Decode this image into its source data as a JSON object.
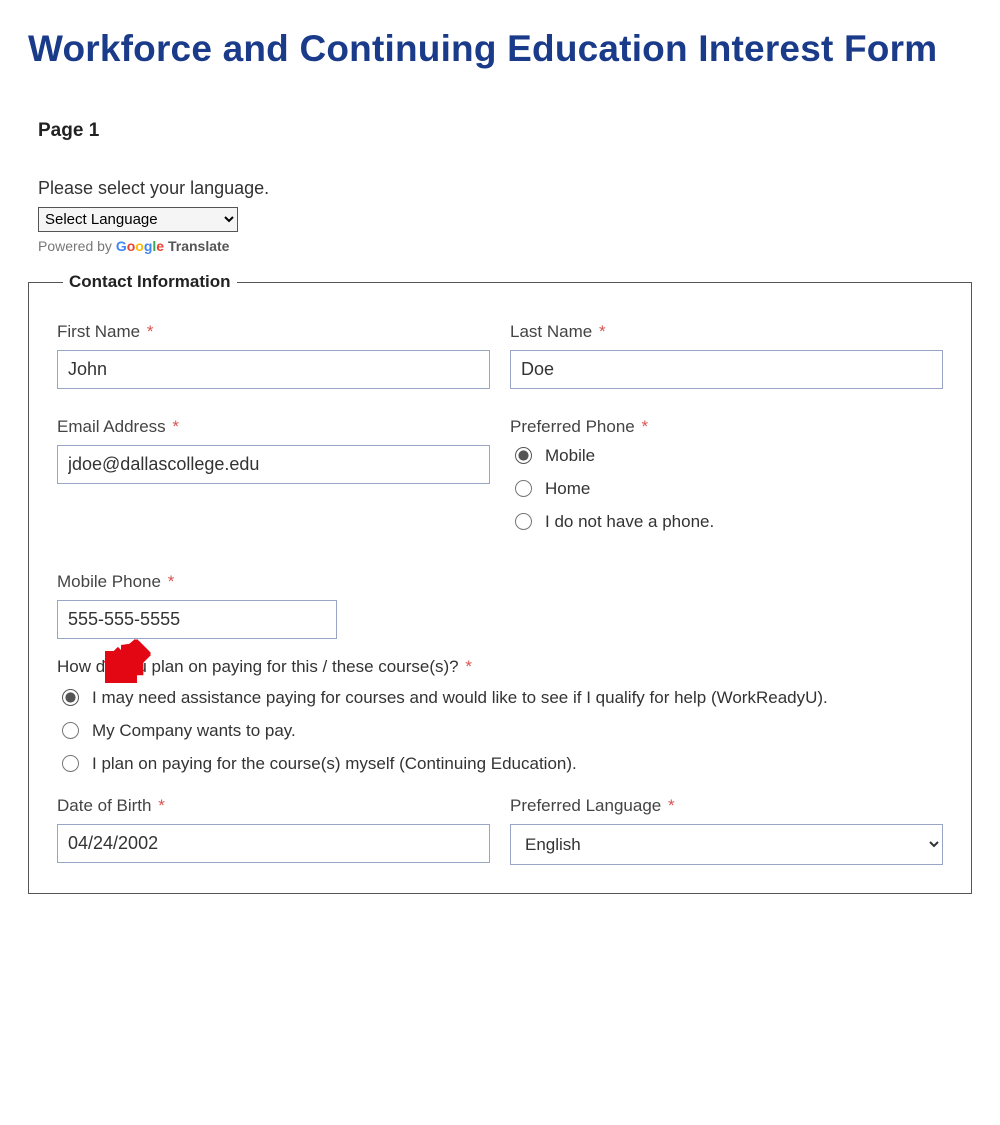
{
  "title": "Workforce and Continuing Education Interest Form",
  "page_label": "Page 1",
  "language": {
    "prompt": "Please select your language.",
    "selected": "Select Language",
    "powered_prefix": "Powered by ",
    "translate_word": "Translate"
  },
  "fieldset_legend": "Contact Information",
  "fields": {
    "first_name": {
      "label": "First Name",
      "value": "John"
    },
    "last_name": {
      "label": "Last Name",
      "value": "Doe"
    },
    "email": {
      "label": "Email Address",
      "value": "jdoe@dallascollege.edu"
    },
    "preferred_phone": {
      "label": "Preferred Phone",
      "options": {
        "mobile": "Mobile",
        "home": "Home",
        "none": "I do not have a phone."
      },
      "selected": "mobile"
    },
    "mobile_phone": {
      "label": "Mobile Phone",
      "value": "555-555-5555"
    },
    "payment": {
      "label": "How do you plan on paying for this / these course(s)?",
      "options": {
        "assist": "I may need assistance paying for courses and would like to see if I qualify for help (WorkReadyU).",
        "company": "My Company wants to pay.",
        "self": "I plan on paying for the course(s) myself (Continuing Education)."
      },
      "selected": "assist"
    },
    "dob": {
      "label": "Date of Birth",
      "value": "04/24/2002"
    },
    "preferred_language": {
      "label": "Preferred Language",
      "value": "English"
    }
  },
  "required_marker": "*"
}
